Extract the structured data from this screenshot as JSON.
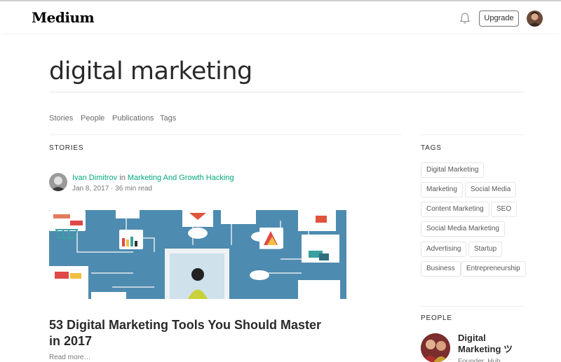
{
  "header": {
    "logo": "Medium",
    "icons": {
      "notifications": "bell-icon"
    },
    "upgrade_label": "Upgrade"
  },
  "search": {
    "query": "digital marketing"
  },
  "tabs": [
    {
      "label": "Stories"
    },
    {
      "label": "People"
    },
    {
      "label": "Publications"
    },
    {
      "label": "Tags"
    }
  ],
  "stories": {
    "section_label": "STORIES",
    "items": [
      {
        "author": "Ivan Dimitrov",
        "connector": "in",
        "publication": "Marketing And Growth Hacking",
        "date": "Jan 8, 2017",
        "read_time": "36 min read",
        "title": "53 Digital Marketing Tools You Should Master in 2017",
        "read_more": "Read more…"
      }
    ]
  },
  "tags_section": {
    "label": "TAGS",
    "tags": [
      "Digital Marketing",
      "Marketing",
      "Social Media",
      "Content Marketing",
      "SEO",
      "Social Media Marketing",
      "Advertising",
      "Startup",
      "Business",
      "Entrepreneurship"
    ]
  },
  "people_section": {
    "label": "PEOPLE",
    "items": [
      {
        "name": "Digital Marketing ツ",
        "sub": "Founder, Hub"
      }
    ]
  },
  "colors": {
    "accent_green": "#03a87c",
    "text": "#222222",
    "hero_bg": "#4e8bb0"
  }
}
